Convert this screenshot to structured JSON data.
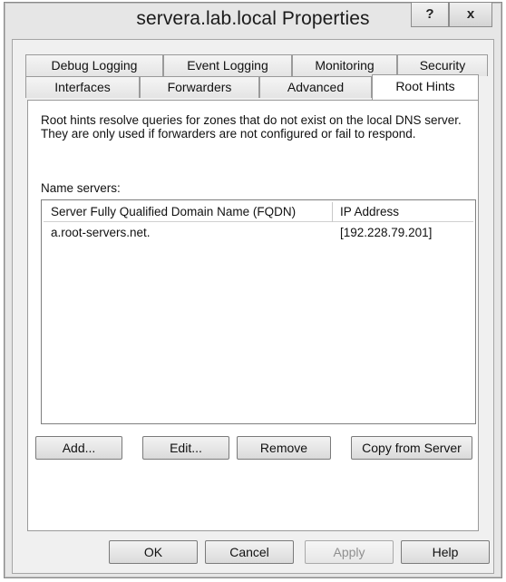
{
  "window": {
    "title": "servera.lab.local Properties",
    "help_glyph": "?",
    "close_glyph": "x"
  },
  "tabs": {
    "row1": [
      "Debug Logging",
      "Event Logging",
      "Monitoring",
      "Security"
    ],
    "row2": [
      "Interfaces",
      "Forwarders",
      "Advanced",
      "Root Hints"
    ],
    "active": "Root Hints"
  },
  "root_hints": {
    "description": "Root hints resolve queries for zones that do not exist on the local DNS server.  They are only used if forwarders are not configured or fail to respond.",
    "name_servers_label": "Name servers:",
    "columns": [
      "Server Fully Qualified Domain Name (FQDN)",
      "IP Address"
    ],
    "rows": [
      {
        "fqdn": "a.root-servers.net.",
        "ip": "[192.228.79.201]"
      }
    ],
    "buttons": {
      "add": "Add...",
      "edit": "Edit...",
      "remove": "Remove",
      "copy": "Copy from Server"
    }
  },
  "footer": {
    "ok": "OK",
    "cancel": "Cancel",
    "apply": "Apply",
    "help": "Help"
  },
  "colors": {
    "window_bg": "#e6e6e6",
    "panel_bg": "#ffffff",
    "disabled_text": "#8f8f8f"
  }
}
